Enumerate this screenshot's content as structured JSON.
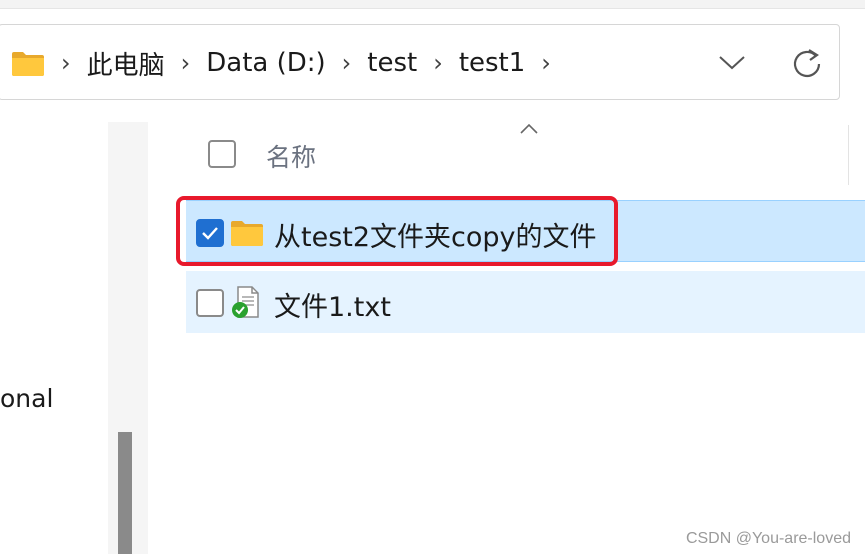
{
  "breadcrumb": [
    "此电脑",
    "Data (D:)",
    "test",
    "test1"
  ],
  "icons": {
    "nav_folder": "folder-icon",
    "separator": "chevron-right-icon",
    "history": "chevron-down-icon",
    "refresh": "refresh-icon",
    "sort": "sort-ascending-icon"
  },
  "navigation_pane": {
    "partial_item_text": "onal"
  },
  "list": {
    "column_name": "名称",
    "rows": [
      {
        "name": "从test2文件夹copy的文件",
        "type": "folder",
        "checked": true,
        "state": "selected"
      },
      {
        "name": "文件1.txt",
        "type": "text-file-synced",
        "checked": false,
        "state": "hover"
      }
    ]
  },
  "annotation_color": "#e8192c",
  "watermark": "CSDN @You-are-loved"
}
